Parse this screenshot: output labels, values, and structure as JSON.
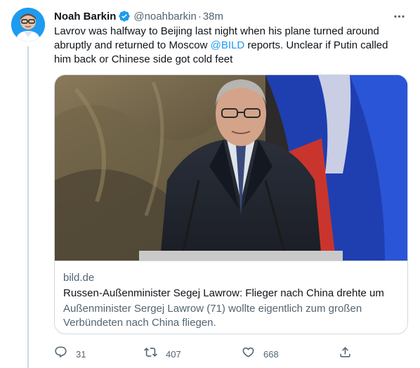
{
  "author": {
    "display_name": "Noah Barkin",
    "handle": "@noahbarkin",
    "separator": "·",
    "time": "38m"
  },
  "tweet": {
    "text_before": "Lavrov was halfway to Beijing last night when his plane turned around abruptly and returned to Moscow ",
    "mention": "@BILD",
    "text_after": " reports. Unclear if Putin called him back or Chinese side got cold feet"
  },
  "card": {
    "domain": "bild.de",
    "title": "Russen-Außenminister Segej Lawrow: Flieger nach China drehte um",
    "description": "Außenminister Sergej Lawrow (71) wollte eigentlich zum großen Verbündeten nach China fliegen."
  },
  "actions": {
    "replies": "31",
    "retweets": "407",
    "likes": "668"
  },
  "colors": {
    "accent": "#1d9bf0",
    "secondary_text": "#536471",
    "border": "#cfd9de"
  },
  "icons": [
    "more-icon",
    "verified-icon",
    "reply-icon",
    "retweet-icon",
    "like-icon",
    "share-icon"
  ]
}
